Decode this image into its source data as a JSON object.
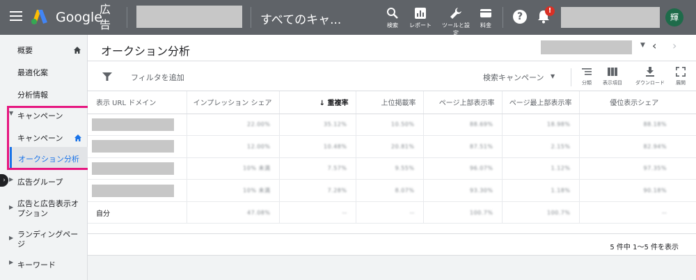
{
  "header": {
    "logo_text": "Google",
    "logo_ads": "広告",
    "account_title": "すべてのキャ...",
    "tools": [
      {
        "label": "検索",
        "icon": "search-icon"
      },
      {
        "label": "レポート",
        "icon": "report-icon"
      },
      {
        "label": "ツールと設定",
        "icon": "wrench-icon"
      },
      {
        "label": "料金",
        "icon": "credit-card-icon"
      }
    ],
    "help_label": "?",
    "notification_badge": "!",
    "avatar_initial": "輝"
  },
  "sidebar": {
    "items": [
      {
        "label": "概要",
        "home": true
      },
      {
        "label": "最適化案"
      },
      {
        "label": "分析情報"
      },
      {
        "label": "キャンペーン",
        "expanded": true
      },
      {
        "label": "キャンペーン",
        "home": true
      },
      {
        "label": "オークション分析",
        "active": true
      },
      {
        "label": "広告グループ"
      },
      {
        "label": "広告と広告表示オプション"
      },
      {
        "label": "ランディングページ"
      },
      {
        "label": "キーワード"
      }
    ],
    "highlight_color": "#e6157f"
  },
  "page": {
    "title": "オークション分析",
    "prev_icon": "‹",
    "next_icon": "›"
  },
  "toolbar": {
    "filter_label": "フィルタを追加",
    "segment_label": "検索キャンペーン",
    "tools": [
      {
        "label": "分類",
        "icon": "segment-icon"
      },
      {
        "label": "表示項目",
        "icon": "columns-icon"
      },
      {
        "label": "ダウンロード",
        "icon": "download-icon"
      },
      {
        "label": "展開",
        "icon": "expand-icon"
      }
    ]
  },
  "table": {
    "headers": [
      "表示 URL ドメイン",
      "インプレッション シェア",
      "重複率",
      "上位掲載率",
      "ページ上部表示率",
      "ページ最上部表示率",
      "優位表示シェア"
    ],
    "sorted_column": "重複率",
    "sort_arrow": "↓",
    "rows": [
      {
        "domain": "",
        "values": [
          "22.00%",
          "35.12%",
          "10.50%",
          "88.69%",
          "18.98%",
          "88.18%"
        ]
      },
      {
        "domain": "",
        "values": [
          "12.00%",
          "10.48%",
          "20.81%",
          "87.51%",
          "2.15%",
          "82.94%"
        ]
      },
      {
        "domain": "",
        "values": [
          "10% 未満",
          "7.57%",
          "9.55%",
          "96.07%",
          "1.12%",
          "97.35%"
        ]
      },
      {
        "domain": "",
        "values": [
          "10% 未満",
          "7.28%",
          "8.07%",
          "93.30%",
          "1.18%",
          "90.18%"
        ]
      },
      {
        "domain": "自分",
        "values": [
          "47.08%",
          "--",
          "--",
          "100.7%",
          "100.7%",
          "--"
        ]
      }
    ]
  },
  "pagination": {
    "text": "5 件中 1～5 件を表示"
  },
  "colors": {
    "topbar": "#5f6368",
    "accent": "#1a73e8",
    "badge": "#d93025",
    "avatar": "#1e6b4a"
  }
}
